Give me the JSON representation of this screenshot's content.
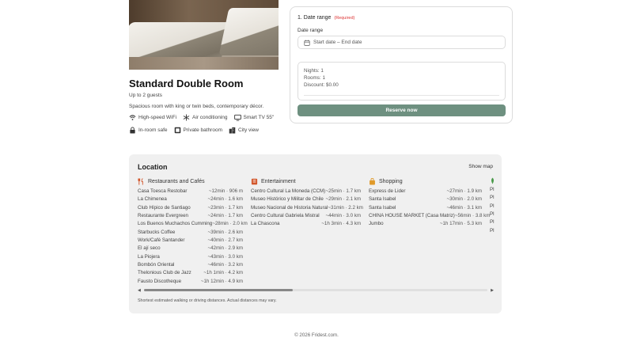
{
  "room": {
    "title": "Standard Double Room",
    "guests": "Up to 2 guests",
    "description": "Spacious room with king or twin beds, contemporary décor.",
    "amenities_row1": [
      {
        "icon": "wifi-icon",
        "label": "High-speed WiFi"
      },
      {
        "icon": "snowflake-icon",
        "label": "Air conditioning"
      },
      {
        "icon": "tv-icon",
        "label": "Smart TV 55\""
      }
    ],
    "amenities_row2": [
      {
        "icon": "lock-icon",
        "label": "In-room safe"
      },
      {
        "icon": "bathroom-icon",
        "label": "Private bathroom"
      },
      {
        "icon": "city-icon",
        "label": "City view"
      }
    ]
  },
  "booking": {
    "step_label": "1. Date range",
    "required_label": "(Required)",
    "date_label": "Date range",
    "date_placeholder": "Start date – End date",
    "nights": "Nights: 1",
    "rooms": "Rooms: 1",
    "discount": "Discount: $0.00",
    "reserve_label": "Reserve now",
    "accent_color": "#6e9080"
  },
  "location": {
    "title": "Location",
    "show_map": "Show map",
    "columns": [
      {
        "heading": "Restaurants and Cafés",
        "icon": "utensils-icon",
        "items": [
          {
            "name": "Casa Toesca Restobar",
            "dist": "~12min · 906 m"
          },
          {
            "name": "La Chimenea",
            "dist": "~24min · 1.6 km"
          },
          {
            "name": "Club Hípico de Santiago",
            "dist": "~23min · 1.7 km"
          },
          {
            "name": "Restaurante Evergreen",
            "dist": "~24min · 1.7 km"
          },
          {
            "name": "Los Buenos Muchachos Cumming",
            "dist": "~28min · 2.0 km"
          },
          {
            "name": "Starbucks Coffee",
            "dist": "~39min · 2.6 km"
          },
          {
            "name": "Work/Café Santander",
            "dist": "~40min · 2.7 km"
          },
          {
            "name": "El ají seco",
            "dist": "~42min · 2.9 km"
          },
          {
            "name": "La Piojera",
            "dist": "~43min · 3.0 km"
          },
          {
            "name": "Bombón Oriental",
            "dist": "~46min · 3.2 km"
          },
          {
            "name": "Thelonious Club de Jazz",
            "dist": "~1h 1min · 4.2 km"
          },
          {
            "name": "Fausto Discotheque",
            "dist": "~1h 12min · 4.9 km"
          }
        ]
      },
      {
        "heading": "Entertainment",
        "icon": "theater-icon",
        "items": [
          {
            "name": "Centro Cultural La Moneda (CCM)",
            "dist": "~25min · 1.7 km"
          },
          {
            "name": "Museo Histórico y Militar de Chile",
            "dist": "~29min · 2.1 km"
          },
          {
            "name": "Museo Nacional de Historia Natural",
            "dist": "~31min · 2.2 km"
          },
          {
            "name": "Centro Cultural Gabriela Mistral",
            "dist": "~44min · 3.0 km"
          },
          {
            "name": "La Chascona",
            "dist": "~1h 3min · 4.3 km"
          }
        ]
      },
      {
        "heading": "Shopping",
        "icon": "shopping-bag-icon",
        "items": [
          {
            "name": "Express de Lider",
            "dist": "~27min · 1.9 km"
          },
          {
            "name": "Santa Isabel",
            "dist": "~30min · 2.0 km"
          },
          {
            "name": "Santa Isabel",
            "dist": "~46min · 3.1 km"
          },
          {
            "name": "CHINA HOUSE MARKET (Casa Matriz)",
            "dist": "~56min · 3.8 km"
          },
          {
            "name": "Jumbo",
            "dist": "~1h 17min · 5.3 km"
          }
        ]
      }
    ],
    "partial_column": [
      "Pl",
      "Pl",
      "Pl",
      "Pl",
      "Pl",
      "Pl"
    ],
    "note": "Shortest estimated walking or driving distances. Actual distances may vary."
  },
  "footer": "© 2026 Fridest.com."
}
